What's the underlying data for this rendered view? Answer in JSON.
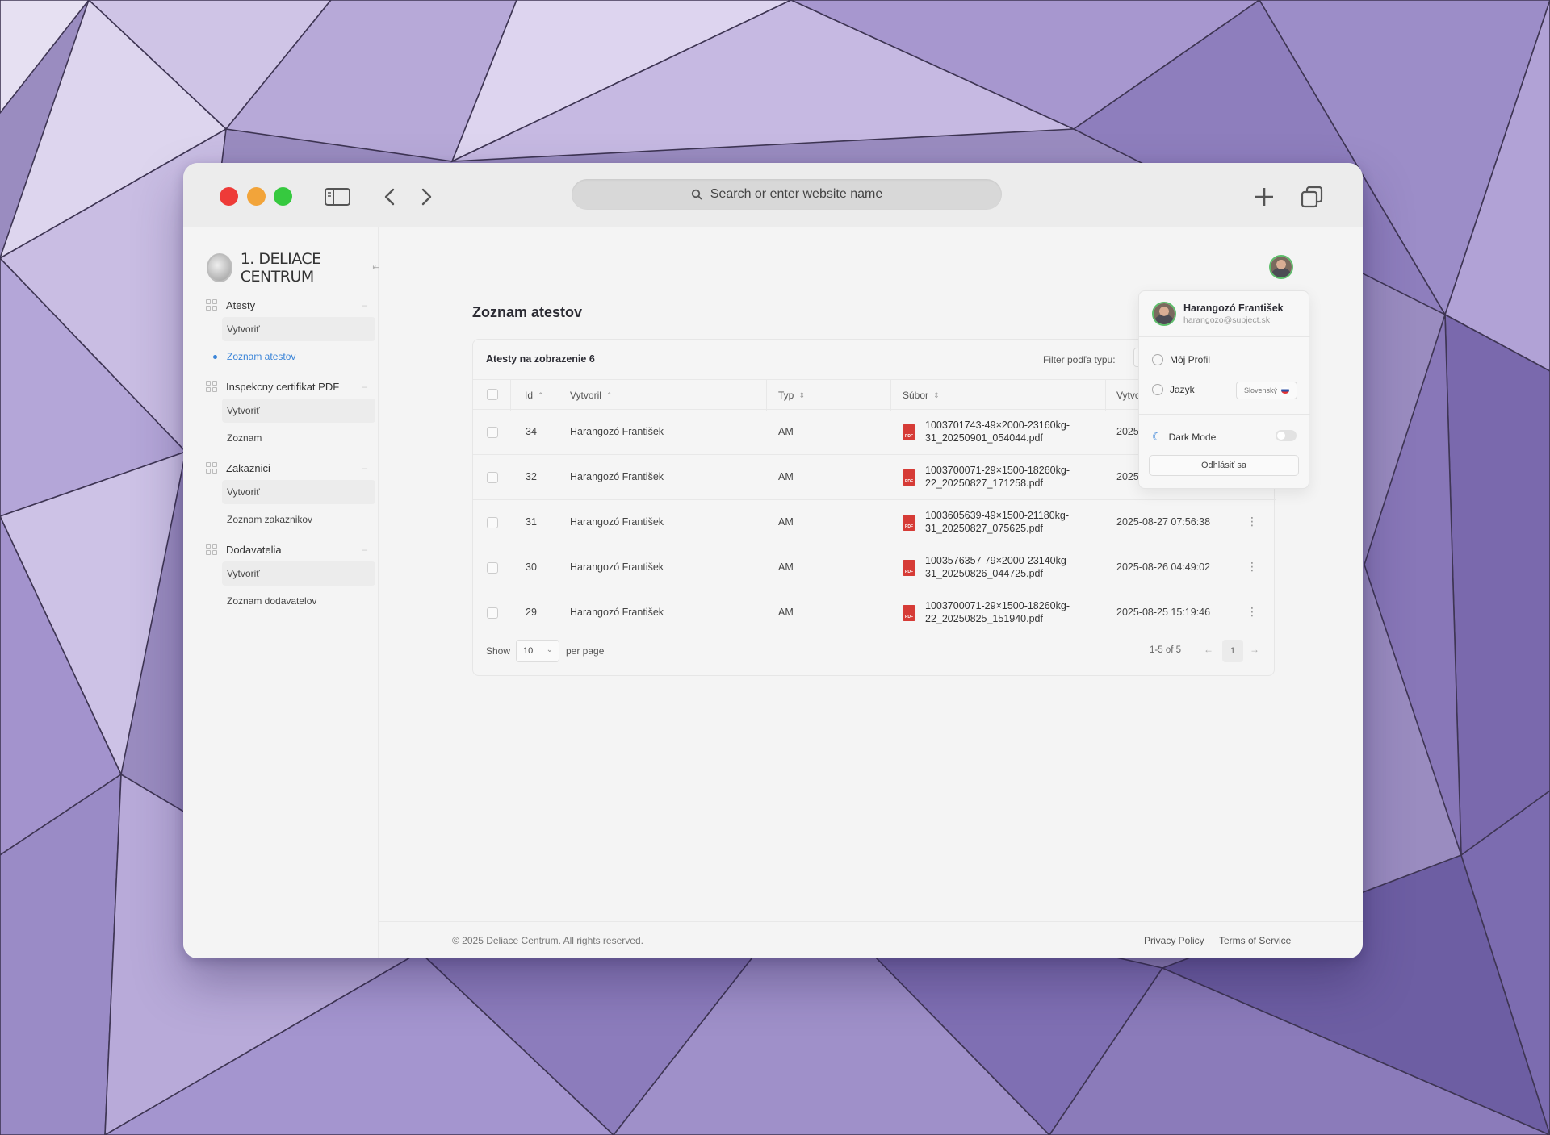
{
  "browser": {
    "address_placeholder": "Search or enter website name"
  },
  "app": {
    "brand": "1. DELIACE CENTRUM",
    "page_title": "Zoznam atestov"
  },
  "sidebar": {
    "groups": [
      {
        "label": "Atesty",
        "items": [
          "Vytvoriť",
          "Zoznam atestov"
        ]
      },
      {
        "label": "Inspekcny certifikat PDF",
        "items": [
          "Vytvoriť",
          "Zoznam"
        ]
      },
      {
        "label": "Zakaznici",
        "items": [
          "Vytvoriť",
          "Zoznam zakaznikov"
        ]
      },
      {
        "label": "Dodavatelia",
        "items": [
          "Vytvoriť",
          "Zoznam dodavatelov"
        ]
      }
    ]
  },
  "table": {
    "title": "Atesty na zobrazenie 6",
    "filter_label": "Filter podľa typu:",
    "columns": [
      "Id",
      "Vytvoril",
      "Typ",
      "Súbor",
      "Vytvo"
    ],
    "rows": [
      {
        "id": "34",
        "author": "Harangozó František",
        "type": "AM",
        "file_line1": "1003701743-49×2000-23160kg-",
        "file_line2": "31_20250901_054044.pdf",
        "created": "2025"
      },
      {
        "id": "32",
        "author": "Harangozó František",
        "type": "AM",
        "file_line1": "1003700071-29×1500-18260kg-",
        "file_line2": "22_20250827_171258.pdf",
        "created": "2025"
      },
      {
        "id": "31",
        "author": "Harangozó František",
        "type": "AM",
        "file_line1": "1003605639-49×1500-21180kg-",
        "file_line2": "31_20250827_075625.pdf",
        "created": "2025-08-27 07:56:38"
      },
      {
        "id": "30",
        "author": "Harangozó František",
        "type": "AM",
        "file_line1": "1003576357-79×2000-23140kg-",
        "file_line2": "31_20250826_044725.pdf",
        "created": "2025-08-26 04:49:02"
      },
      {
        "id": "29",
        "author": "Harangozó František",
        "type": "AM",
        "file_line1": "1003700071-29×1500-18260kg-",
        "file_line2": "22_20250825_151940.pdf",
        "created": "2025-08-25 15:19:46"
      }
    ],
    "pager": {
      "show_label": "Show",
      "per_page_value": "10",
      "per_page_label": "per page",
      "range": "1-5 of 5",
      "current_page": "1",
      "prev": "←",
      "next": "→"
    }
  },
  "user_menu": {
    "name": "Harangozó František",
    "email": "harangozo@subject.sk",
    "profile_label": "Môj Profil",
    "language_label": "Jazyk",
    "language_value": "Slovenský",
    "dark_mode_label": "Dark Mode",
    "dark_mode_on": false,
    "logout_label": "Odhlásiť sa"
  },
  "footer": {
    "copyright": "© 2025 Deliace Centrum. All rights reserved.",
    "privacy": "Privacy Policy",
    "terms": "Terms of Service"
  },
  "colors": {
    "accent": "#3a84d8",
    "pdf": "#d63b36",
    "traffic_red": "#ee3b38",
    "traffic_yellow": "#f2a43a",
    "traffic_green": "#36c93f"
  }
}
